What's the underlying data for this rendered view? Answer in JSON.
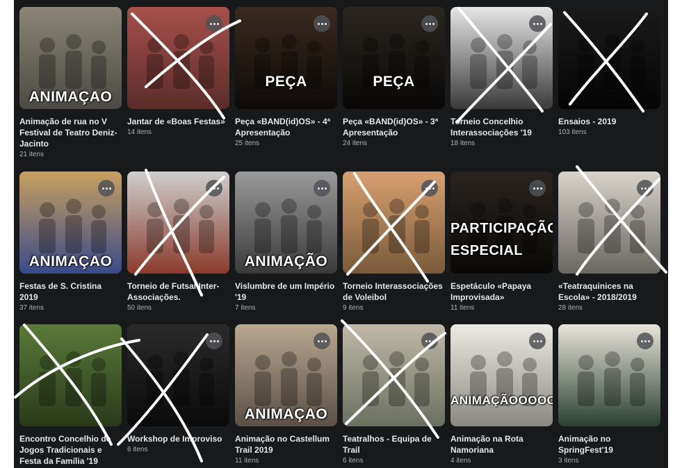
{
  "albums": [
    {
      "title": "Animação de rua no V Festival de Teatro Deniz-Jacinto",
      "count": "21 itens",
      "overlay": "ANIMAÇAO",
      "bg": [
        "#8a8577",
        "#4c4a44"
      ],
      "more": false,
      "crossed": false
    },
    {
      "title": "Jantar de «Boas Festas»",
      "count": "14 itens",
      "overlay": "",
      "bg": [
        "#a8504a",
        "#5a2c2a"
      ],
      "more": true,
      "crossed": true
    },
    {
      "title": "Peça «BAND(id)OS» - 4ª Apresentação",
      "count": "25 itens",
      "overlay": "PEÇA",
      "bg": [
        "#3a2a20",
        "#0d0a08"
      ],
      "more": true,
      "crossed": false
    },
    {
      "title": "Peça «BAND(id)OS» - 3ª Apresentação",
      "count": "24 itens",
      "overlay": "PEÇA",
      "bg": [
        "#2c2620",
        "#080706"
      ],
      "more": true,
      "crossed": false
    },
    {
      "title": "Torneio Concelhio Interassociações '19",
      "count": "18 itens",
      "overlay": "",
      "bg": [
        "#e6e6e6",
        "#3a3a3a"
      ],
      "more": true,
      "crossed": true
    },
    {
      "title": "Ensaios - 2019",
      "count": "103 itens",
      "overlay": "",
      "bg": [
        "#1a1a1a",
        "#050505"
      ],
      "more": false,
      "crossed": true
    },
    {
      "title": "Festas de S. Cristina 2019",
      "count": "37 itens",
      "overlay": "ANIMAÇAO",
      "bg": [
        "#c8a060",
        "#3a4a8a"
      ],
      "more": true,
      "crossed": false
    },
    {
      "title": "Torneio de Futsal Inter-Associações.",
      "count": "50 itens",
      "overlay": "",
      "bg": [
        "#cfcfcf",
        "#8a3a2a"
      ],
      "more": true,
      "crossed": true
    },
    {
      "title": "Vislumbre de um Império '19",
      "count": "7 itens",
      "overlay": "ANIMAÇÃO",
      "bg": [
        "#9a9a9a",
        "#3a3a3a"
      ],
      "more": true,
      "crossed": false
    },
    {
      "title": "Torneio Interassociações de Voleibol",
      "count": "9 itens",
      "overlay": "",
      "bg": [
        "#d8a070",
        "#7a5a3a"
      ],
      "more": true,
      "crossed": true
    },
    {
      "title": "Espetáculo «Papaya Improvisada»",
      "count": "11 itens",
      "overlay": "PARTICIPAÇÃO ESPECIAL",
      "bg": [
        "#2a2420",
        "#0a0806"
      ],
      "more": true,
      "crossed": false
    },
    {
      "title": "«Teatraquinices na Escola» - 2018/2019",
      "count": "28 itens",
      "overlay": "",
      "bg": [
        "#d8d4cc",
        "#6a6660"
      ],
      "more": true,
      "crossed": true
    },
    {
      "title": "Encontro Concelhio de Jogos Tradicionais e Festa da Família '19",
      "count": "",
      "overlay": "",
      "bg": [
        "#5a7a3a",
        "#2a3a1a"
      ],
      "more": false,
      "crossed": true
    },
    {
      "title": "Workshop de Improviso",
      "count": "6 itens",
      "overlay": "",
      "bg": [
        "#2a2a2a",
        "#0a0a0a"
      ],
      "more": true,
      "crossed": true
    },
    {
      "title": "Animação no Castellum Trail 2019",
      "count": "11 itens",
      "overlay": "ANIMAÇAO",
      "bg": [
        "#b8a890",
        "#5a5048"
      ],
      "more": true,
      "crossed": false
    },
    {
      "title": "Teatralhos - Equipa de Trail",
      "count": "6 itens",
      "overlay": "",
      "bg": [
        "#c0b8a8",
        "#6a7060"
      ],
      "more": true,
      "crossed": true
    },
    {
      "title": "Animação na Rota Namoriana",
      "count": "4 itens",
      "overlay": "ANIMAÇÃOOOOOOOO",
      "bg": [
        "#eceae4",
        "#8a8880"
      ],
      "more": true,
      "crossed": false
    },
    {
      "title": "Animação no SpringFest'19",
      "count": "3 itens",
      "overlay": "",
      "bg": [
        "#e8e4dc",
        "#2a4030"
      ],
      "more": true,
      "crossed": false
    }
  ]
}
